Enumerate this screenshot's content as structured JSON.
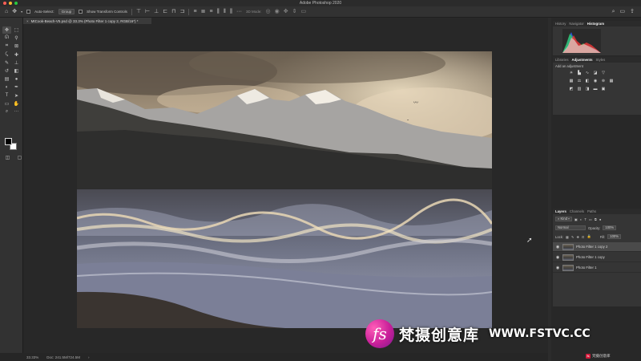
{
  "window": {
    "title": "Adobe Photoshop 2020"
  },
  "options_bar": {
    "auto_select_label": "Auto-Select:",
    "auto_select_value": "Group",
    "show_transform_label": "Show Transform Controls",
    "mode_3d_label": "3D Mode:"
  },
  "document": {
    "tab_label": "MtCook-Beach-V5.psd @ 33.3% (Photo Filter 1 copy 2, RGB/16*) *"
  },
  "statusbar": {
    "zoom": "33.33%",
    "doc_size": "Doc: 241.5M/724.5M"
  },
  "panels": {
    "top_tabs": [
      "History",
      "Navigator",
      "Histogram"
    ],
    "top_active": "Histogram",
    "mid_tabs": [
      "Libraries",
      "Adjustments",
      "Styles"
    ],
    "mid_active": "Adjustments",
    "add_adjustment": "Add an adjustment",
    "layer_tabs": [
      "Layers",
      "Channels",
      "Paths"
    ],
    "layer_active": "Layers",
    "kind_filter": "Kind",
    "blend_mode": "Normal",
    "opacity_label": "Opacity:",
    "opacity_value": "100%",
    "lock_label": "Lock:",
    "fill_label": "Fill:",
    "fill_value": "100%",
    "layers": [
      {
        "name": "Photo Filter 1 copy 2",
        "selected": true
      },
      {
        "name": "Photo Filter 1 copy",
        "selected": false
      },
      {
        "name": "Photo Filter 1",
        "selected": false
      }
    ]
  },
  "watermark": {
    "brand": "梵摄创意库",
    "url": "WWW.FSTVC.CC",
    "small": "梵摄创意库"
  },
  "colors": {
    "ui_bg": "#323232",
    "canvas_bg": "#282828",
    "accent_pink": "#c81f99"
  }
}
